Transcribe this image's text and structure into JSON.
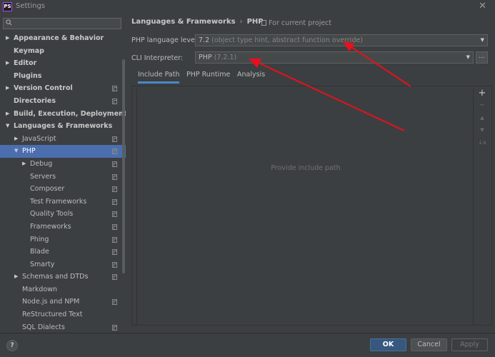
{
  "window": {
    "title": "Settings",
    "app_icon_text": "PS"
  },
  "search": {
    "placeholder": ""
  },
  "tree": [
    {
      "label": "Appearance & Behavior",
      "arrow": "right",
      "level": 0,
      "bold": true,
      "copy": false
    },
    {
      "label": "Keymap",
      "arrow": "",
      "level": 0,
      "bold": true,
      "copy": false
    },
    {
      "label": "Editor",
      "arrow": "right",
      "level": 0,
      "bold": true,
      "copy": false
    },
    {
      "label": "Plugins",
      "arrow": "",
      "level": 0,
      "bold": true,
      "copy": false
    },
    {
      "label": "Version Control",
      "arrow": "right",
      "level": 0,
      "bold": true,
      "copy": true
    },
    {
      "label": "Directories",
      "arrow": "",
      "level": 0,
      "bold": true,
      "copy": true
    },
    {
      "label": "Build, Execution, Deployment",
      "arrow": "right",
      "level": 0,
      "bold": true,
      "copy": false
    },
    {
      "label": "Languages & Frameworks",
      "arrow": "down",
      "level": 0,
      "bold": true,
      "copy": false
    },
    {
      "label": "JavaScript",
      "arrow": "right",
      "level": 1,
      "bold": false,
      "copy": true
    },
    {
      "label": "PHP",
      "arrow": "down",
      "level": 1,
      "bold": false,
      "copy": true,
      "selected": true
    },
    {
      "label": "Debug",
      "arrow": "right",
      "level": 2,
      "bold": false,
      "copy": true
    },
    {
      "label": "Servers",
      "arrow": "",
      "level": 2,
      "bold": false,
      "copy": true
    },
    {
      "label": "Composer",
      "arrow": "",
      "level": 2,
      "bold": false,
      "copy": true
    },
    {
      "label": "Test Frameworks",
      "arrow": "",
      "level": 2,
      "bold": false,
      "copy": true
    },
    {
      "label": "Quality Tools",
      "arrow": "",
      "level": 2,
      "bold": false,
      "copy": true
    },
    {
      "label": "Frameworks",
      "arrow": "",
      "level": 2,
      "bold": false,
      "copy": true
    },
    {
      "label": "Phing",
      "arrow": "",
      "level": 2,
      "bold": false,
      "copy": true
    },
    {
      "label": "Blade",
      "arrow": "",
      "level": 2,
      "bold": false,
      "copy": true
    },
    {
      "label": "Smarty",
      "arrow": "",
      "level": 2,
      "bold": false,
      "copy": true
    },
    {
      "label": "Schemas and DTDs",
      "arrow": "right",
      "level": 1,
      "bold": false,
      "copy": true
    },
    {
      "label": "Markdown",
      "arrow": "",
      "level": 1,
      "bold": false,
      "copy": false
    },
    {
      "label": "Node.js and NPM",
      "arrow": "",
      "level": 1,
      "bold": false,
      "copy": true
    },
    {
      "label": "ReStructured Text",
      "arrow": "",
      "level": 1,
      "bold": false,
      "copy": false
    },
    {
      "label": "SQL Dialects",
      "arrow": "",
      "level": 1,
      "bold": false,
      "copy": true
    }
  ],
  "breadcrumb": {
    "parent": "Languages & Frameworks",
    "separator": "›",
    "current": "PHP",
    "scope": "For current project"
  },
  "php_level": {
    "label": "PHP language level:",
    "value": "7.2",
    "hint": "(object type hint, abstract function override)"
  },
  "cli": {
    "label": "CLI Interpreter:",
    "value": "PHP",
    "hint": "(7.2.1)",
    "browse": "..."
  },
  "tabs": [
    "Include Path",
    "PHP Runtime",
    "Analysis"
  ],
  "include_panel": {
    "empty_text": "Provide include path"
  },
  "toolbar": {
    "add": "+",
    "remove": "−",
    "up": "▲",
    "down": "▼",
    "sort": "↓a"
  },
  "footer": {
    "help": "?",
    "ok": "OK",
    "cancel": "Cancel",
    "apply": "Apply"
  },
  "colors": {
    "accent": "#4b6eaf",
    "annotation": "#e8101c"
  }
}
